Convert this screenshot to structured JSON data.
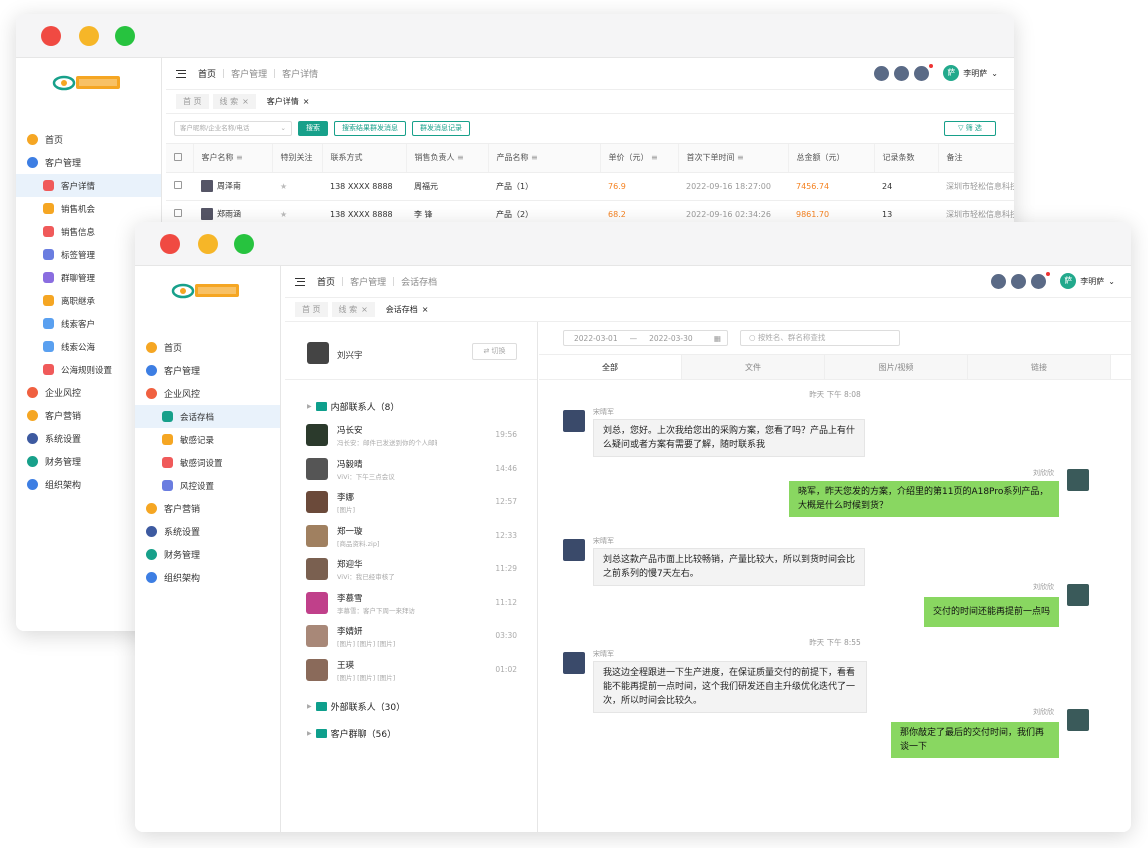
{
  "w1": {
    "breadcrumb": [
      "首页",
      "客户管理",
      "客户详情"
    ],
    "user": {
      "avatar": "萨",
      "name": "李明萨"
    },
    "tags": [
      {
        "label": "首 页",
        "close": false
      },
      {
        "label": "线 索",
        "close": true
      },
      {
        "label": "客户详情",
        "close": true
      }
    ],
    "filter": {
      "placeholder": "客户昵称/企业名称/电话",
      "search": "搜索",
      "btn1": "搜索结果群发消息",
      "btn2": "群发消息记录",
      "screen": "筛 选"
    },
    "nav": [
      {
        "label": "首页",
        "sub": false,
        "color": "#f5a623"
      },
      {
        "label": "客户管理",
        "sub": false,
        "color": "#3d7ee3"
      },
      {
        "label": "客户详情",
        "sub": true,
        "color": "#f05a5a",
        "active": true
      },
      {
        "label": "销售机会",
        "sub": true,
        "color": "#f5a623"
      },
      {
        "label": "销售信息",
        "sub": true,
        "color": "#f05a5a"
      },
      {
        "label": "标签管理",
        "sub": true,
        "color": "#6a7de0"
      },
      {
        "label": "群聊管理",
        "sub": true,
        "color": "#8a6de0"
      },
      {
        "label": "离职继承",
        "sub": true,
        "color": "#f5a623"
      },
      {
        "label": "线索客户",
        "sub": true,
        "color": "#5aa0f0"
      },
      {
        "label": "线索公海",
        "sub": true,
        "color": "#5aa0f0"
      },
      {
        "label": "公海规则设置",
        "sub": true,
        "color": "#f05a5a"
      },
      {
        "label": "企业风控",
        "sub": false,
        "color": "#f06040"
      },
      {
        "label": "客户营销",
        "sub": false,
        "color": "#f5a623"
      },
      {
        "label": "系统设置",
        "sub": false,
        "color": "#3d5aa0"
      },
      {
        "label": "财务管理",
        "sub": false,
        "color": "#17a08a"
      },
      {
        "label": "组织架构",
        "sub": false,
        "color": "#3d7ee3"
      }
    ],
    "columns": [
      "客户名称",
      "特别关注",
      "联系方式",
      "销售负责人",
      "产品名称",
      "单价（元）",
      "首次下单时间",
      "总金额（元）",
      "记录条数",
      "备注"
    ],
    "rows": [
      [
        "周泽南",
        "138 XXXX 8888",
        "周福元",
        "产品（1）",
        "76.9",
        "2022-09-16 18:27:00",
        "7456.74",
        "24",
        "深圳市轻松信息科技"
      ],
      [
        "郑雨涵",
        "138 XXXX 8888",
        "李 锋",
        "产品（2）",
        "68.2",
        "2022-09-16 02:34:26",
        "9861.70",
        "13",
        "深圳市轻松信息科技"
      ]
    ]
  },
  "w2": {
    "breadcrumb": [
      "首页",
      "客户管理",
      "会话存档"
    ],
    "user": {
      "avatar": "萨",
      "name": "李明萨"
    },
    "tags": [
      {
        "label": "首 页",
        "close": false
      },
      {
        "label": "线 索",
        "close": true
      },
      {
        "label": "会话存档",
        "close": true
      }
    ],
    "nav": [
      {
        "label": "首页",
        "sub": false,
        "color": "#f5a623"
      },
      {
        "label": "客户管理",
        "sub": false,
        "color": "#3d7ee3"
      },
      {
        "label": "企业风控",
        "sub": false,
        "color": "#f06040"
      },
      {
        "label": "会话存档",
        "sub": true,
        "color": "#17a08a",
        "active": true
      },
      {
        "label": "敏感记录",
        "sub": true,
        "color": "#f5a623"
      },
      {
        "label": "敏感词设置",
        "sub": true,
        "color": "#f05a5a"
      },
      {
        "label": "风控设置",
        "sub": true,
        "color": "#6a7de0"
      },
      {
        "label": "客户营销",
        "sub": false,
        "color": "#f5a623"
      },
      {
        "label": "系统设置",
        "sub": false,
        "color": "#3d5aa0"
      },
      {
        "label": "财务管理",
        "sub": false,
        "color": "#17a08a"
      },
      {
        "label": "组织架构",
        "sub": false,
        "color": "#3d7ee3"
      }
    ],
    "me": {
      "name": "刘兴宇",
      "switch": "⇄ 切换"
    },
    "groups": [
      {
        "label": "内部联系人（8）"
      },
      {
        "label": "外部联系人（30）"
      },
      {
        "label": "客户群聊（56）"
      }
    ],
    "contacts": [
      {
        "name": "冯长安",
        "snippet": "冯长安：邮件已发送到你的个人邮箱",
        "time": "19:56",
        "color": "#2b3a2c"
      },
      {
        "name": "冯毅晴",
        "snippet": "ViVi：下午三点会议",
        "time": "14:46",
        "color": "#555"
      },
      {
        "name": "李娜",
        "snippet": "[图片]",
        "time": "12:57",
        "color": "#6b4a3a"
      },
      {
        "name": "郑一璇",
        "snippet": "[商品资料.zip]",
        "time": "12:33",
        "color": "#a08060"
      },
      {
        "name": "郑迎华",
        "snippet": "ViVi：我已经审核了",
        "time": "11:29",
        "color": "#7a6050"
      },
      {
        "name": "李慕雪",
        "snippet": "李慕雪：客户下周一来拜访",
        "time": "11:12",
        "color": "#c0408a"
      },
      {
        "name": "李婧妍",
        "snippet": "[图片] [图片] [图片]",
        "time": "03:30",
        "color": "#a88878"
      },
      {
        "name": "王瑛",
        "snippet": "[图片] [图片] [图片]",
        "time": "01:02",
        "color": "#8a6a5a"
      }
    ],
    "date": {
      "from": "2022-03-01",
      "sep": "—",
      "to": "2022-03-30"
    },
    "search_placeholder": "按姓名、群名称查找",
    "tabs": [
      "全部",
      "文件",
      "图片/视频",
      "链接"
    ],
    "messages": {
      "t1": "昨天  下午 8:08",
      "t2": "昨天  下午 8:55",
      "other": "宋晴军",
      "me": "刘欣欣",
      "m1": "刘总，您好。上次我给您出的采购方案，您看了吗？产品上有什么疑问或者方案有需要了解，随时联系我",
      "m2": "晓军，昨天您发的方案，介绍里的第11页的A18Pro系列产品，大概是什么时候到货？",
      "m3": "刘总这款产品市面上比较畅销，产量比较大，所以到货时间会比之前系列的慢7天左右。",
      "m4": "交付的时间还能再提前一点吗",
      "m5": "我这边全程跟进一下生产进度，在保证质量交付的前提下，看看能不能再提前一点时间，这个我们研发还自主升级优化迭代了一次，所以时间会比较久。",
      "m6": "那你敲定了最后的交付时间，我们再谈一下"
    }
  }
}
